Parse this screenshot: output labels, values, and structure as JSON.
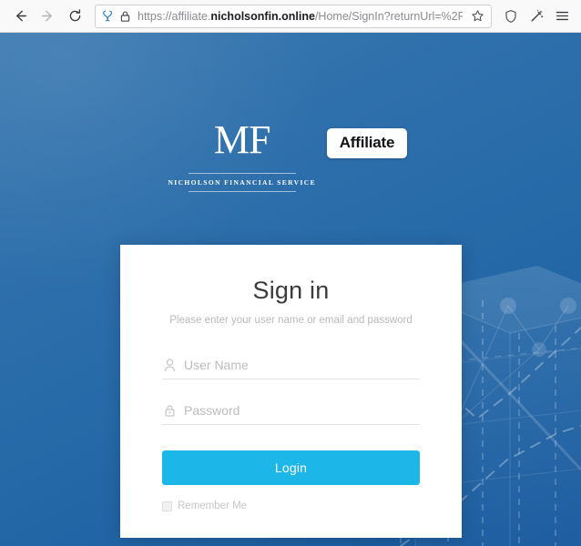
{
  "browser": {
    "back_label": "Back",
    "forward_label": "Forward",
    "reload_label": "Reload",
    "tracking_protection_label": "Tracking protection",
    "lock_label": "Connection secure",
    "url_prefix": "https://affiliate.",
    "url_domain": "nicholsonfin.online",
    "url_suffix": "/Home/SignIn?returnUrl=%2F",
    "url_full": "https://affiliate.nicholsonfin.online/Home/SignIn?returnUrl=%2F",
    "bookmark_label": "Bookmark this page",
    "shield_label": "Shield",
    "extension_label": "Extension",
    "menu_label": "Open application menu"
  },
  "brand": {
    "monogram": "MF",
    "company": "NICHOLSON FINANCIAL SERVICE",
    "badge": "Affiliate"
  },
  "signin": {
    "title": "Sign in",
    "subtitle": "Please enter your user name or email and password",
    "username_placeholder": "User Name",
    "username_value": "",
    "password_placeholder": "Password",
    "password_value": "",
    "login_label": "Login",
    "remember_label": "Remember Me"
  },
  "colors": {
    "page_blue_top": "#3c7ab1",
    "page_blue_bottom": "#1a5a9e",
    "login_button": "#1cb7e8",
    "card_background": "#ffffff",
    "badge_background": "#ffffff"
  }
}
